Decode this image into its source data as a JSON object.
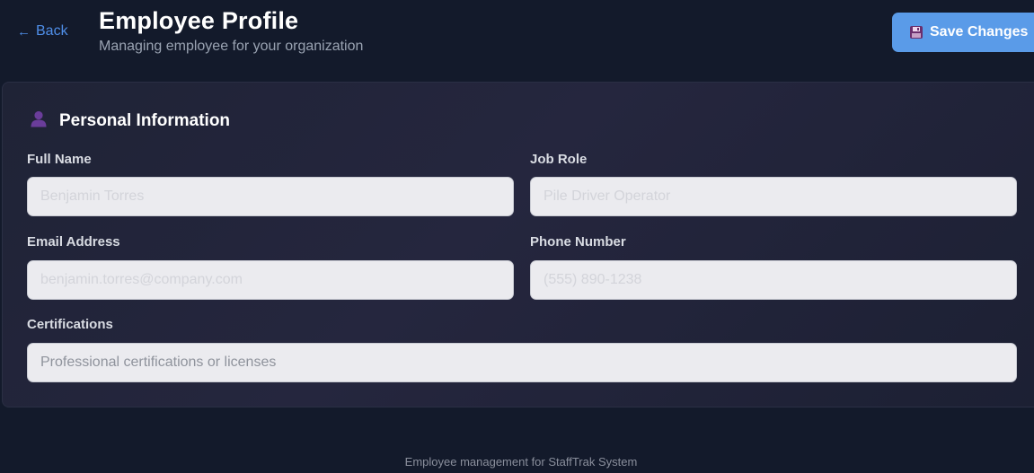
{
  "header": {
    "back_label": "Back",
    "back_arrow": "←",
    "title": "Employee Profile",
    "subtitle": "Managing employee for your organization",
    "save_label": "Save Changes"
  },
  "section": {
    "title": "Personal Information",
    "icon": "person-icon"
  },
  "fields": {
    "full_name": {
      "label": "Full Name",
      "placeholder": "Benjamin Torres"
    },
    "job_role": {
      "label": "Job Role",
      "placeholder": "Pile Driver Operator"
    },
    "email": {
      "label": "Email Address",
      "placeholder": "benjamin.torres@company.com"
    },
    "phone": {
      "label": "Phone Number",
      "placeholder": "(555) 890-1238"
    },
    "certifications": {
      "label": "Certifications",
      "placeholder": "Professional certifications or licenses"
    }
  },
  "footer": {
    "text": "Employee management for StaffTrak System"
  },
  "colors": {
    "background": "#131a2b",
    "accent": "#5a9be8",
    "link": "#4f8ee8"
  }
}
